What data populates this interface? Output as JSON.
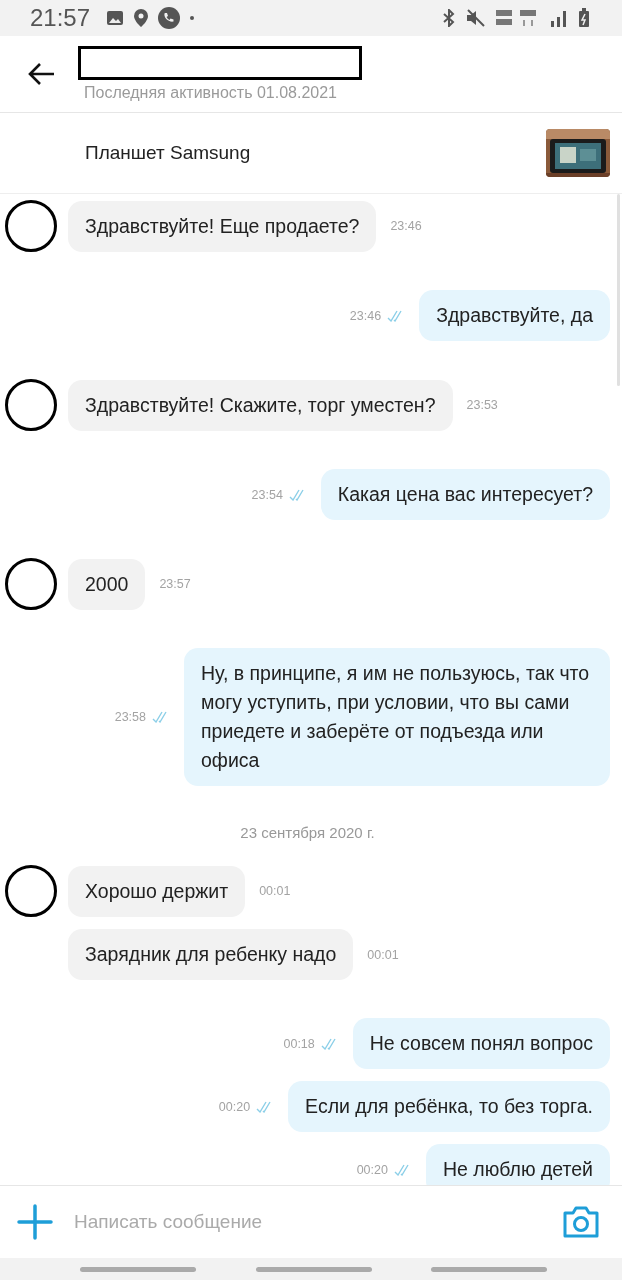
{
  "status_bar": {
    "time": "21:57"
  },
  "header": {
    "last_seen": "Последняя активность 01.08.2021"
  },
  "listing": {
    "title": "Планшет Samsung"
  },
  "messages": [
    {
      "kind": "incoming",
      "text": "Здравствуйте! Еще продаете?",
      "time": "23:46",
      "avatar": true
    },
    {
      "kind": "outgoing",
      "text": "Здравствуйте, да",
      "time": "23:46",
      "read": true
    },
    {
      "kind": "incoming",
      "text": "Здравствуйте! Скажите, торг уместен?",
      "time": "23:53",
      "avatar": true
    },
    {
      "kind": "outgoing",
      "text": "Какая цена вас интересует?",
      "time": "23:54",
      "read": true
    },
    {
      "kind": "incoming",
      "text": "2000",
      "time": "23:57",
      "avatar": true
    },
    {
      "kind": "outgoing",
      "text": "Ну, в принципе, я им не пользуюсь, так что могу уступить, при условии, что вы сами приедете и заберёте от подъезда или офиса",
      "time": "23:58",
      "read": true
    },
    {
      "kind": "date",
      "text": "23 сентября 2020 г."
    },
    {
      "kind": "incoming",
      "text": "Хорошо держит",
      "time": "00:01",
      "avatar": true
    },
    {
      "kind": "incoming",
      "text": "Зарядник для ребенку надо",
      "time": "00:01",
      "avatar": false
    },
    {
      "kind": "outgoing",
      "text": "Не совсем понял вопрос",
      "time": "00:18",
      "read": true
    },
    {
      "kind": "outgoing",
      "text": "Если для ребёнка, то без торга.",
      "time": "00:20",
      "read": true
    },
    {
      "kind": "outgoing",
      "text": "Не люблю детей",
      "time": "00:20",
      "read": true
    }
  ],
  "composer": {
    "placeholder": "Написать сообщение"
  }
}
